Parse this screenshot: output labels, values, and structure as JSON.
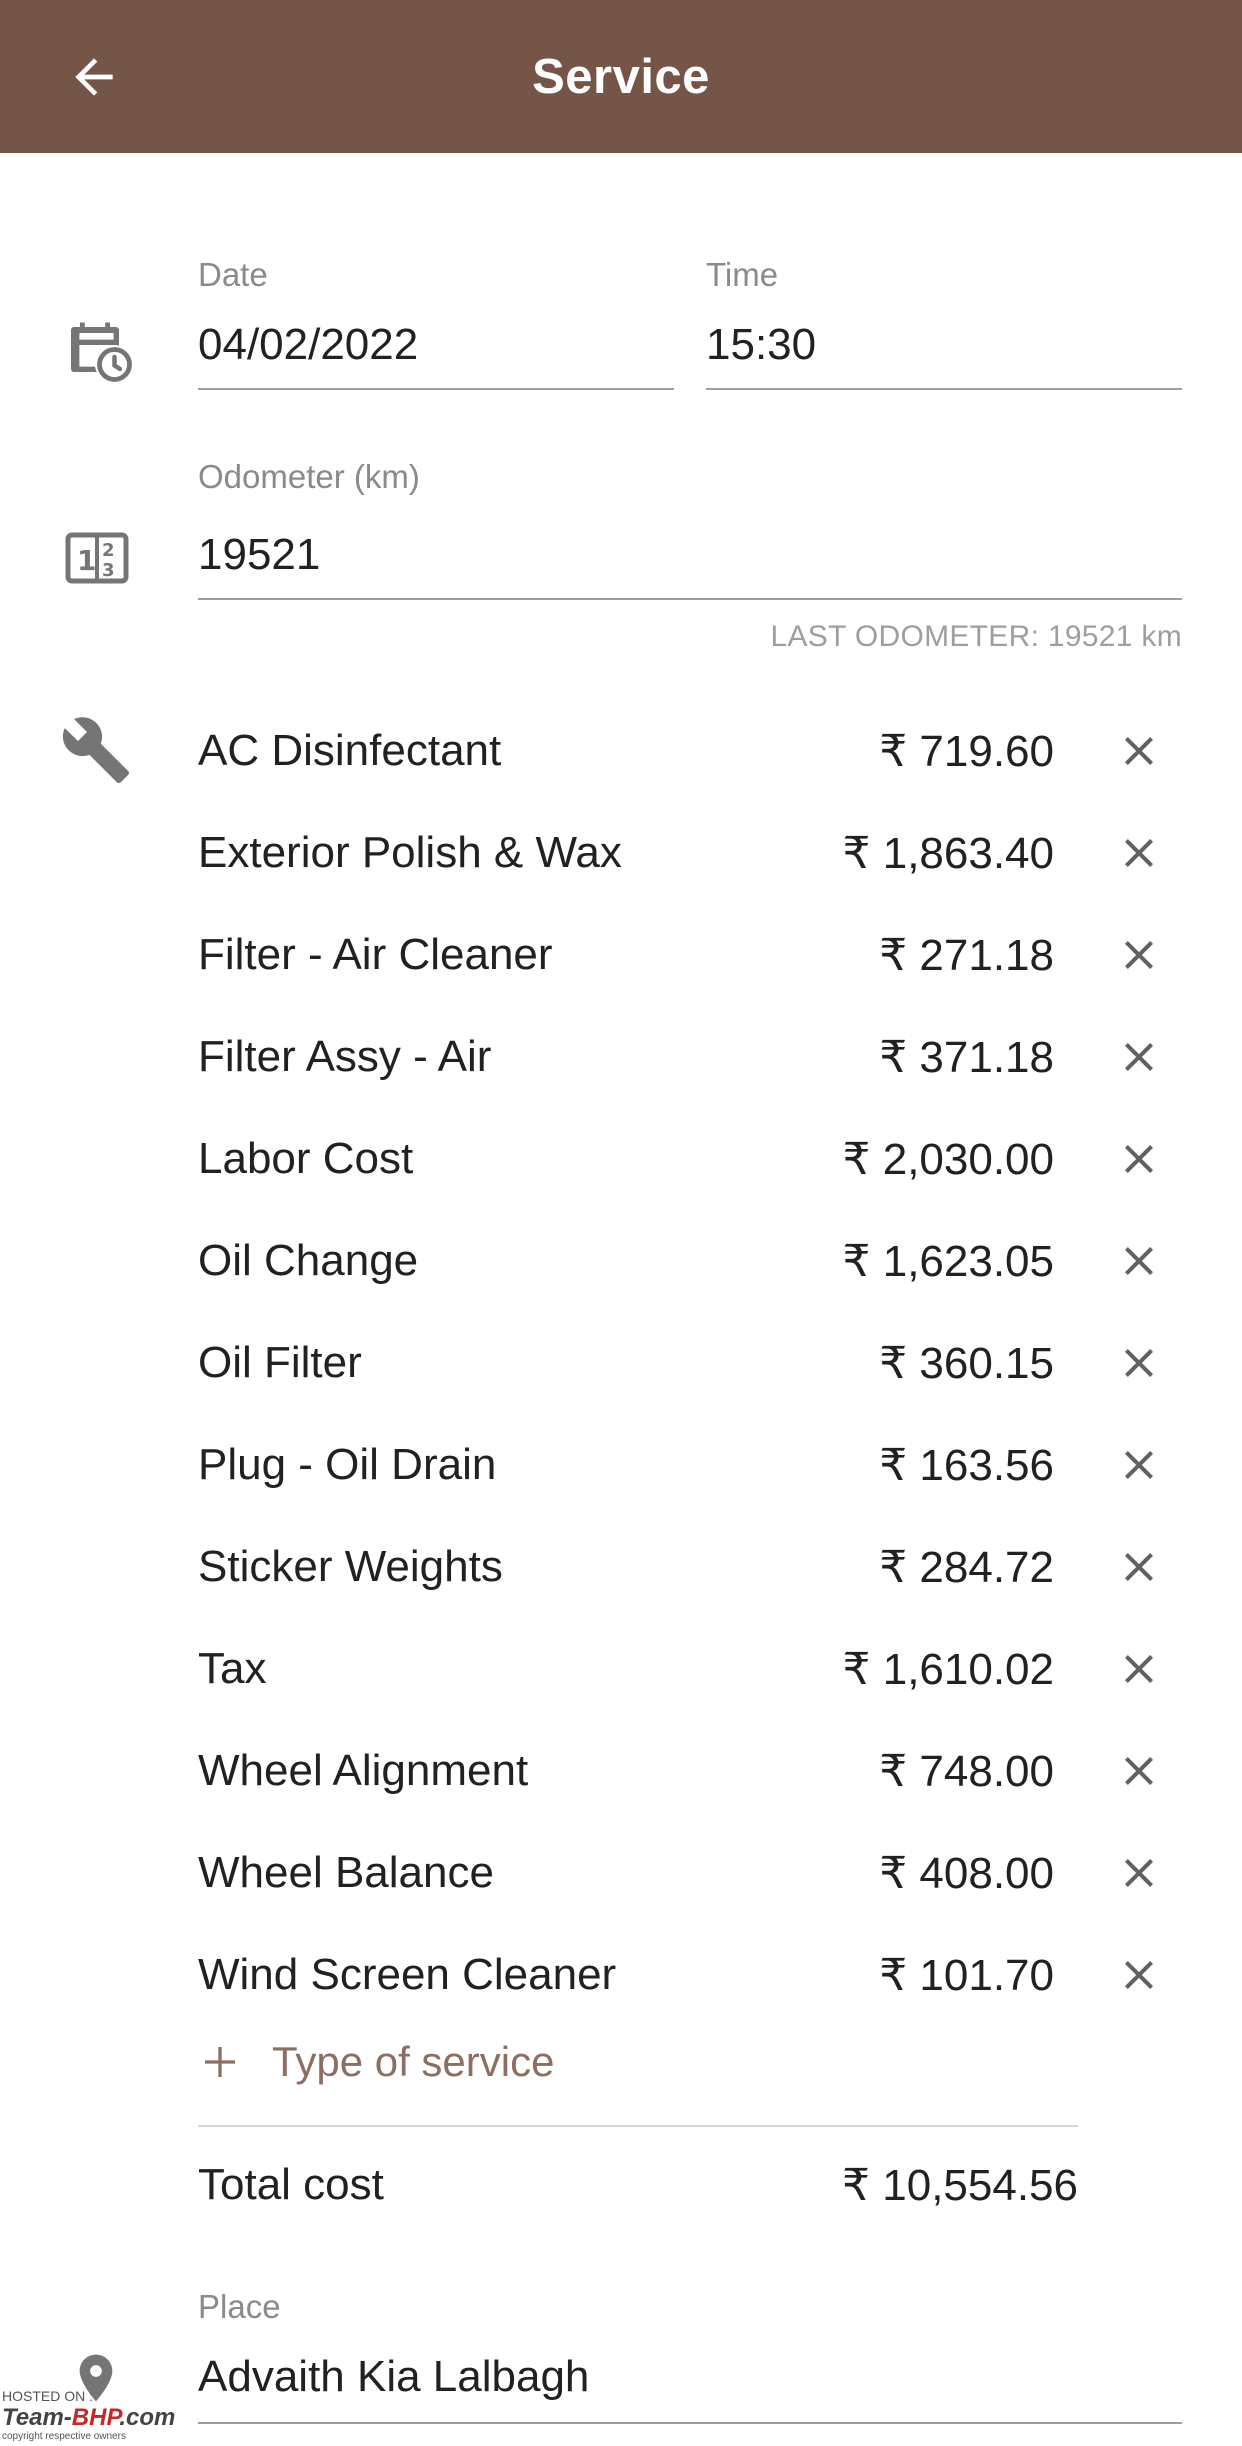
{
  "appbar": {
    "title": "Service",
    "back_icon": "arrow-back-icon"
  },
  "datetime": {
    "icon": "calendar-clock-icon",
    "date_label": "Date",
    "date_value": "04/02/2022",
    "time_label": "Time",
    "time_value": "15:30"
  },
  "odometer": {
    "icon": "odometer-icon",
    "label": "Odometer (km)",
    "value": "19521",
    "hint": "LAST ODOMETER: 19521 km"
  },
  "services": {
    "icon": "wrench-icon",
    "items": [
      {
        "name": "AC Disinfectant",
        "price": "₹ 719.60"
      },
      {
        "name": "Exterior Polish & Wax",
        "price": "₹ 1,863.40"
      },
      {
        "name": "Filter - Air Cleaner",
        "price": "₹ 271.18"
      },
      {
        "name": "Filter Assy - Air",
        "price": "₹ 371.18"
      },
      {
        "name": "Labor Cost",
        "price": "₹ 2,030.00"
      },
      {
        "name": "Oil Change",
        "price": "₹ 1,623.05"
      },
      {
        "name": "Oil Filter",
        "price": "₹ 360.15"
      },
      {
        "name": "Plug - Oil Drain",
        "price": "₹ 163.56"
      },
      {
        "name": "Sticker Weights",
        "price": "₹ 284.72"
      },
      {
        "name": "Tax",
        "price": "₹ 1,610.02"
      },
      {
        "name": "Wheel Alignment",
        "price": "₹ 748.00"
      },
      {
        "name": "Wheel Balance",
        "price": "₹ 408.00"
      },
      {
        "name": "Wind Screen Cleaner",
        "price": "₹ 101.70"
      }
    ],
    "add_label": "Type of service",
    "total_label": "Total cost",
    "total_value": "₹ 10,554.56"
  },
  "place": {
    "icon": "location-pin-icon",
    "label": "Place",
    "value": "Advaith Kia Lalbagh"
  },
  "watermark": {
    "hosted": "HOSTED ON :",
    "brand_a": "Team-",
    "brand_b": "BHP",
    "brand_c": ".com",
    "copyright": "copyright respective owners"
  },
  "colors": {
    "appbar": "#755548",
    "accent": "#8d6e63",
    "icon": "#757575"
  }
}
